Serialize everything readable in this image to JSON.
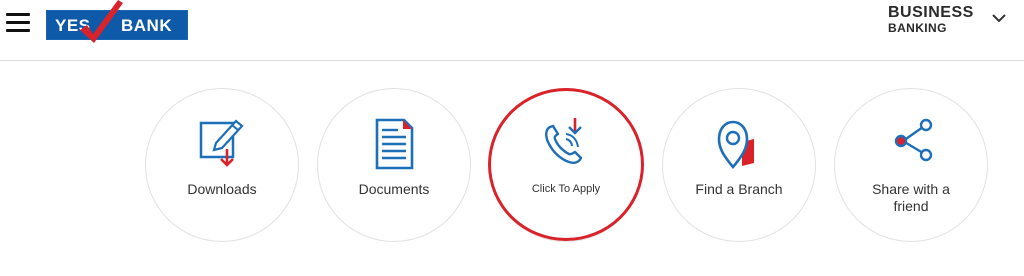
{
  "header": {
    "menu_icon": "hamburger-menu-icon",
    "logo": {
      "left_text": "YES",
      "right_text": "BANK",
      "bg_color": "#0f5aa8",
      "tick_color": "#d9222a"
    },
    "business_banking": {
      "line1": "BUSINESS",
      "line2": "BANKING",
      "icon": "chevron-down-icon"
    }
  },
  "quick_links": [
    {
      "label": "Downloads",
      "icon": "download-document-icon"
    },
    {
      "label": "Documents",
      "icon": "documents-icon"
    },
    {
      "label": "Click To Apply",
      "icon": "phone-call-icon"
    },
    {
      "label": "Find a Branch",
      "icon": "map-pin-icon"
    },
    {
      "label": "Share with a friend",
      "icon": "share-icon"
    }
  ],
  "colors": {
    "icon_blue": "#1d6fb8",
    "icon_red": "#d9222a",
    "highlight_red": "#d9222a",
    "divider": "#dcdcdc"
  }
}
